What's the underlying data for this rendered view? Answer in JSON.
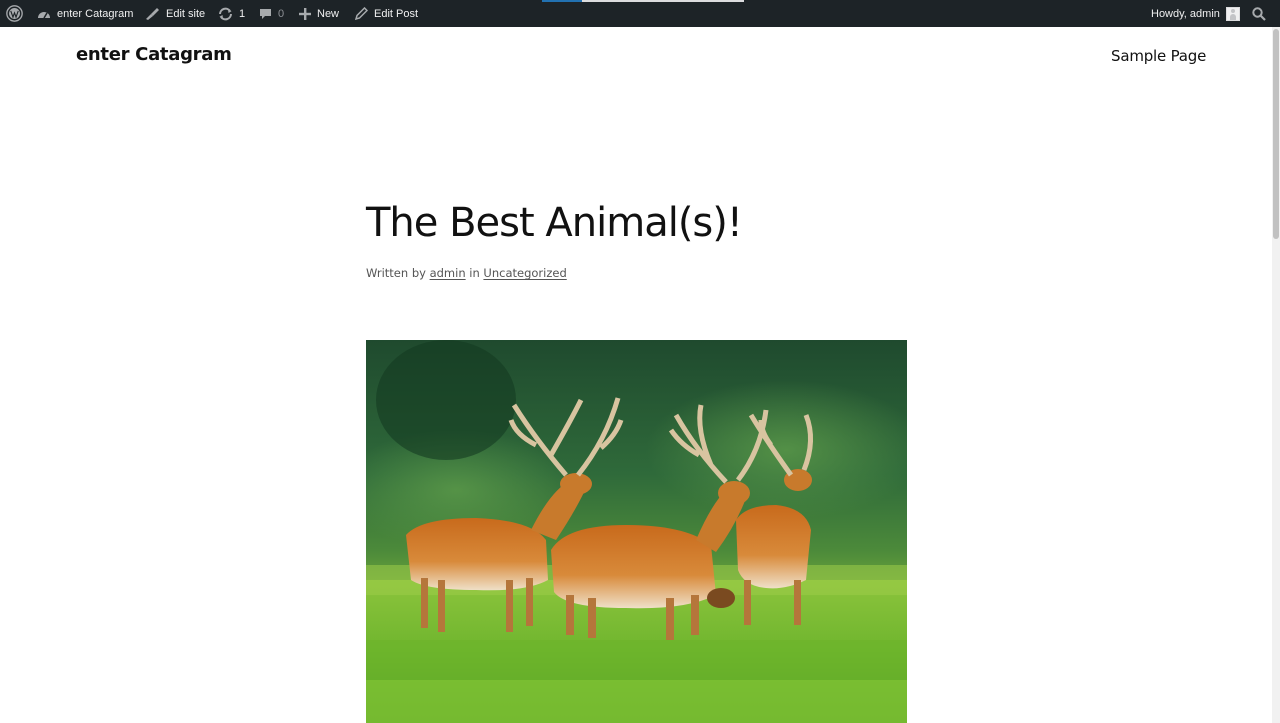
{
  "adminbar": {
    "site_name": "enter Catagram",
    "edit_site": "Edit site",
    "updates_count": "1",
    "comments_count": "0",
    "new_label": "New",
    "edit_post": "Edit Post",
    "howdy": "Howdy, admin",
    "icons": [
      "wordpress-logo-icon",
      "dashboard-icon",
      "brush-icon",
      "updates-icon",
      "comment-icon",
      "plus-icon",
      "pencil-icon",
      "avatar-icon",
      "search-icon"
    ]
  },
  "header": {
    "site_title": "enter Catagram",
    "nav": [
      "Sample Page"
    ]
  },
  "post": {
    "title": "The Best Animal(s)!",
    "meta_written_by": "Written by",
    "meta_author": "admin",
    "meta_in": "in",
    "meta_category": "Uncategorized"
  },
  "image": {
    "subject": "deer-herd-in-meadow"
  },
  "colors": {
    "adminbar_bg": "#1d2327",
    "adminbar_text": "#f0f0f1",
    "text": "#111111",
    "accent_blue": "#2271b1"
  }
}
